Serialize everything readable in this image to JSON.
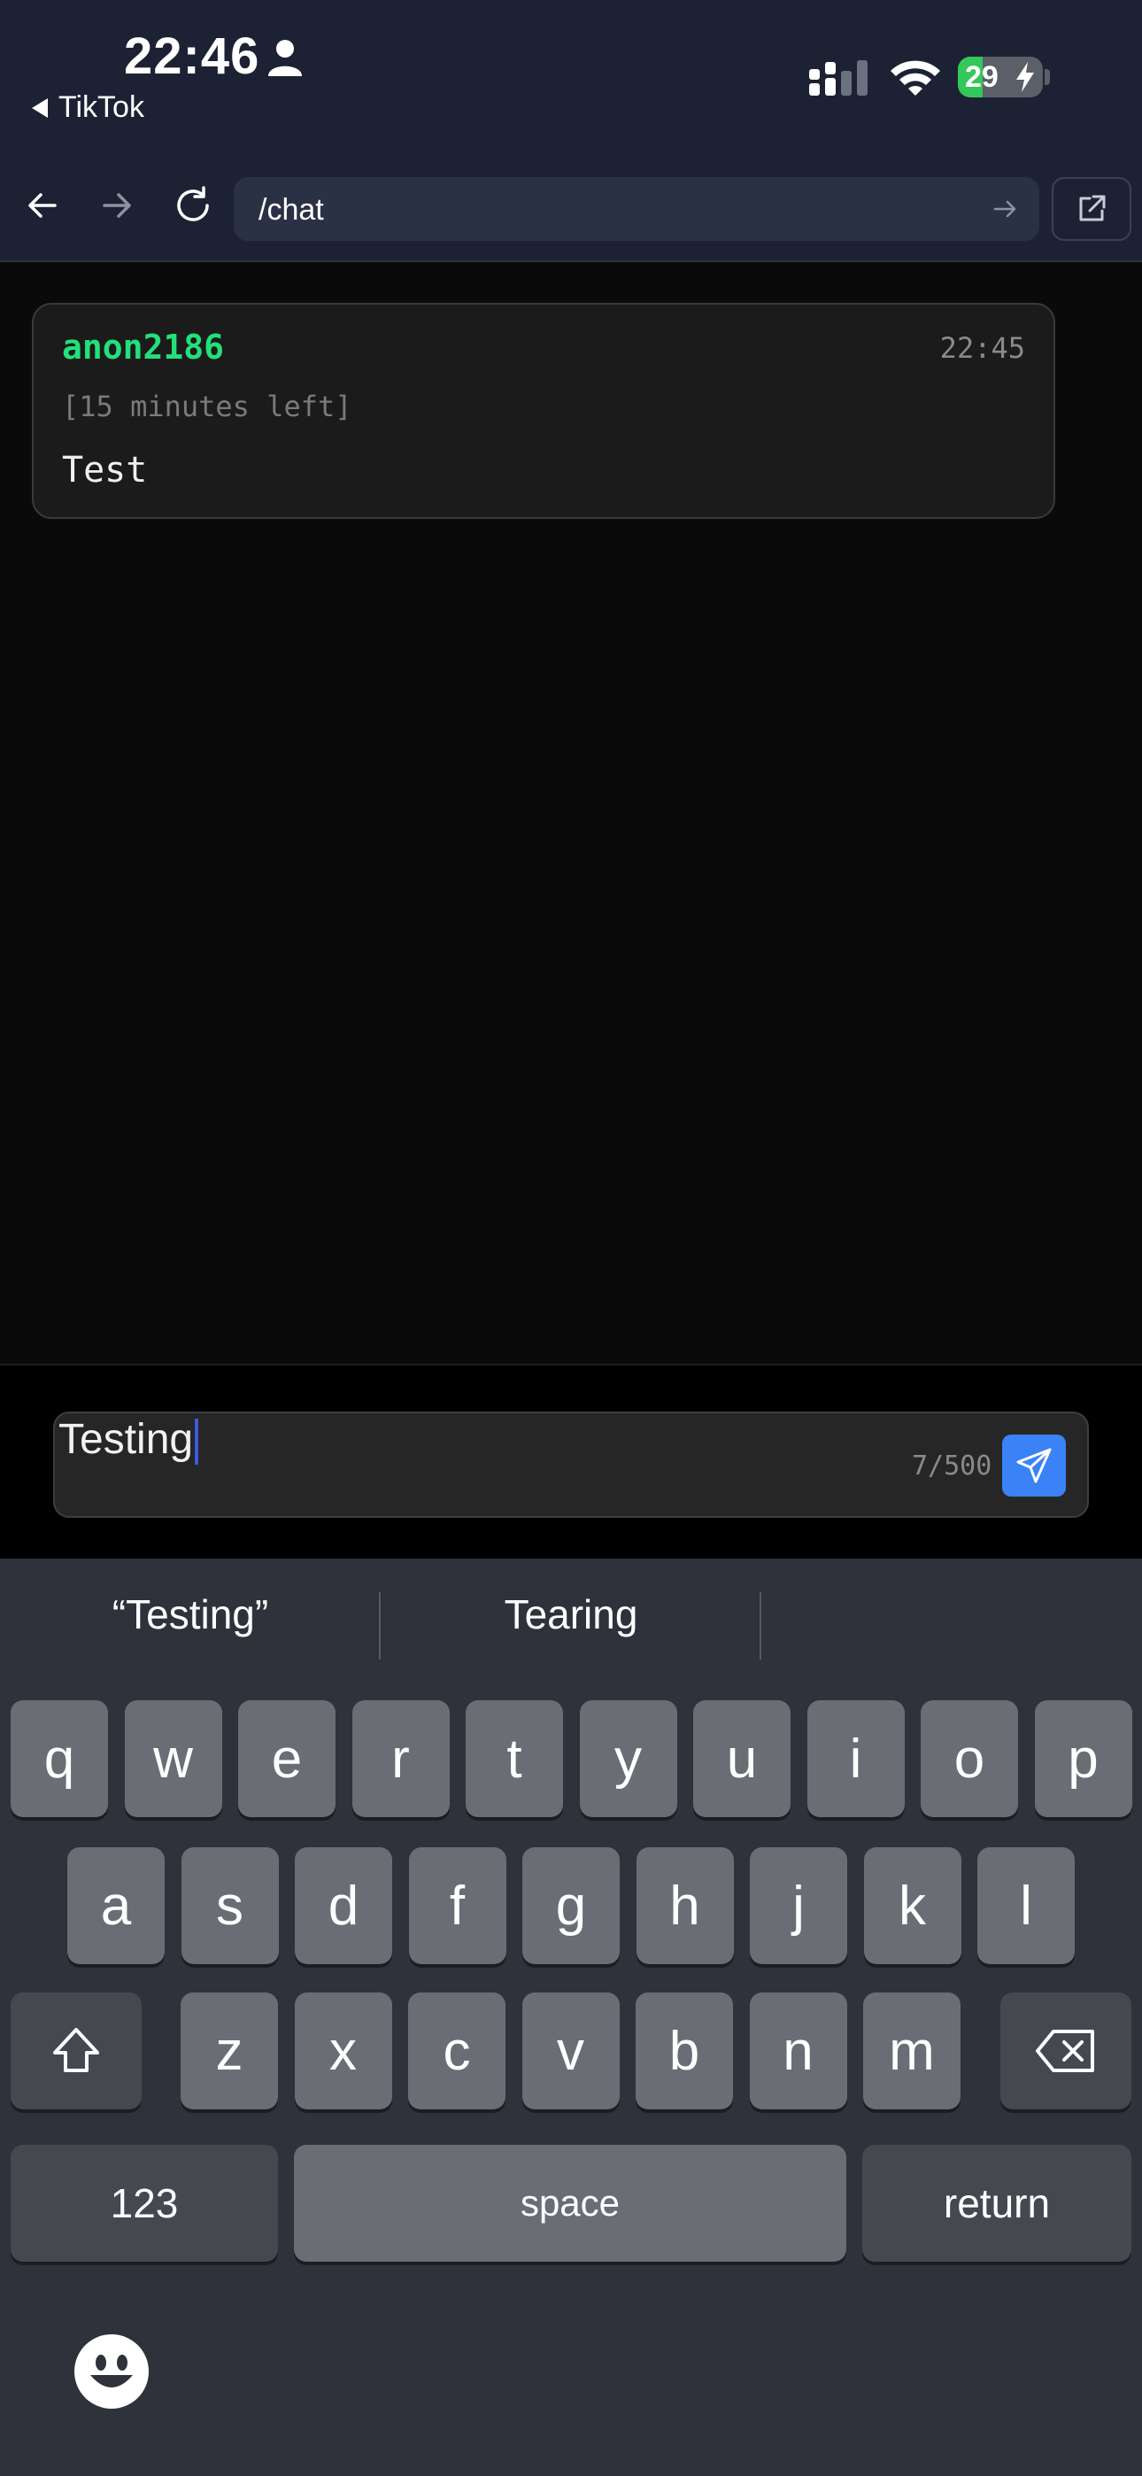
{
  "status_bar": {
    "time": "22:46",
    "back_app": "TikTok",
    "battery_percent": "29",
    "battery_level": 0.29,
    "colors": {
      "battery_fill": "#34c759"
    }
  },
  "browser": {
    "url": "/chat",
    "icons": [
      "back-arrow-icon",
      "forward-arrow-icon",
      "reload-icon",
      "go-arrow-icon",
      "open-external-icon"
    ]
  },
  "message": {
    "username": "anon2186",
    "time": "22:45",
    "expiry": "[15 minutes left]",
    "body": "Test",
    "colors": {
      "username": "#22e07a"
    }
  },
  "composer": {
    "value": "Testing",
    "counter": "7/500",
    "colors": {
      "send_button": "#3b82f6"
    }
  },
  "keyboard": {
    "suggestions": [
      "“Testing”",
      "Tearing",
      ""
    ],
    "row1": [
      "q",
      "w",
      "e",
      "r",
      "t",
      "y",
      "u",
      "i",
      "o",
      "p"
    ],
    "row2": [
      "a",
      "s",
      "d",
      "f",
      "g",
      "h",
      "j",
      "k",
      "l"
    ],
    "row3": [
      "z",
      "x",
      "c",
      "v",
      "b",
      "n",
      "m"
    ],
    "numbers_label": "123",
    "space_label": "space",
    "return_label": "return"
  }
}
